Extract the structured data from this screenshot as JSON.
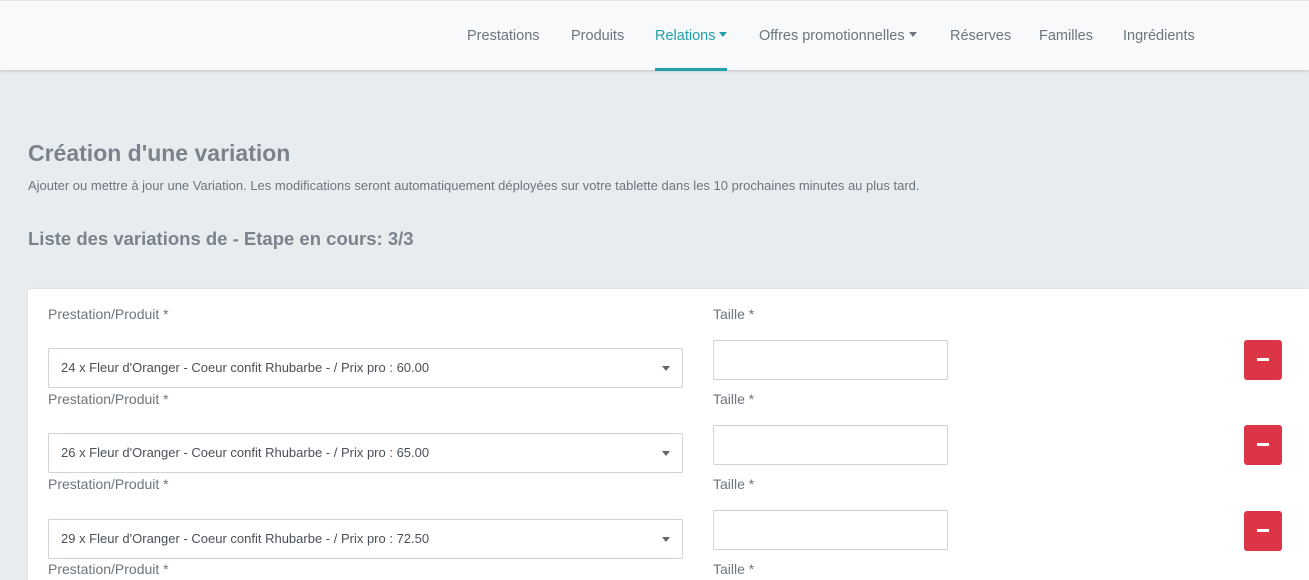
{
  "nav": {
    "items": [
      {
        "label": "Prestations",
        "active": false,
        "dropdown": false
      },
      {
        "label": "Produits",
        "active": false,
        "dropdown": false
      },
      {
        "label": "Relations",
        "active": true,
        "dropdown": true
      },
      {
        "label": "Offres promotionnelles",
        "active": false,
        "dropdown": true
      },
      {
        "label": "Réserves",
        "active": false,
        "dropdown": false
      },
      {
        "label": "Familles",
        "active": false,
        "dropdown": false
      },
      {
        "label": "Ingrédients",
        "active": false,
        "dropdown": false
      }
    ],
    "accent_color": "#20a0a8"
  },
  "page": {
    "title": "Création d'une variation",
    "subtitle": "Ajouter ou mettre à jour une Variation. Les modifications seront automatiquement déployées sur votre tablette dans les 10 prochaines minutes au plus tard.",
    "list_title": "Liste des variations de - Etape en cours: 3/3"
  },
  "form": {
    "product_label": "Prestation/Produit *",
    "size_label": "Taille *",
    "remove_color": "#dc3545",
    "rows": [
      {
        "product": "24 x Fleur d'Oranger - Coeur confit Rhubarbe - / Prix pro : 60.00",
        "size": ""
      },
      {
        "product": "26 x Fleur d'Oranger - Coeur confit Rhubarbe - / Prix pro : 65.00",
        "size": ""
      },
      {
        "product": "29 x Fleur d'Oranger - Coeur confit Rhubarbe - / Prix pro : 72.50",
        "size": ""
      },
      {
        "product": "",
        "size": ""
      }
    ]
  }
}
